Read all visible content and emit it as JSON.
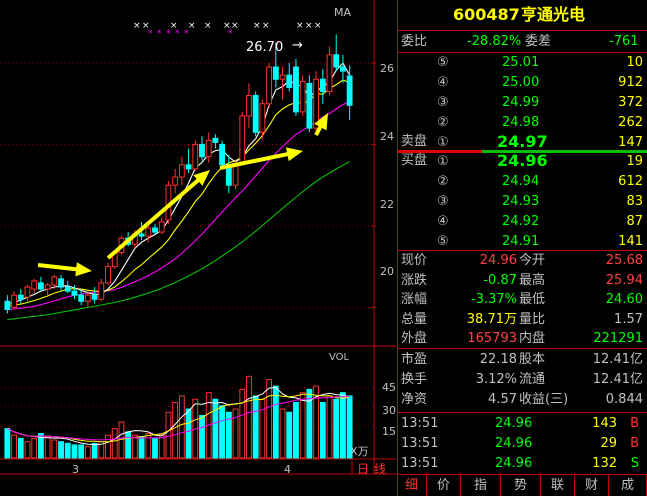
{
  "stock": {
    "code": "600487",
    "name": "亨通光电"
  },
  "weibi": {
    "label_ratio": "委比",
    "ratio": "-28.82%",
    "label_diff": "委差",
    "diff": "-761"
  },
  "sell_side_label": "卖盘",
  "buy_side_label": "买盘",
  "sell_orders": [
    {
      "level": "⑤",
      "price": "25.01",
      "volume": "10"
    },
    {
      "level": "④",
      "price": "25.00",
      "volume": "912"
    },
    {
      "level": "③",
      "price": "24.99",
      "volume": "372"
    },
    {
      "level": "②",
      "price": "24.98",
      "volume": "262"
    },
    {
      "level": "①",
      "price": "24.97",
      "volume": "147"
    }
  ],
  "buy_orders": [
    {
      "level": "①",
      "price": "24.96",
      "volume": "19"
    },
    {
      "level": "②",
      "price": "24.94",
      "volume": "612"
    },
    {
      "level": "③",
      "price": "24.93",
      "volume": "83"
    },
    {
      "level": "④",
      "price": "24.92",
      "volume": "87"
    },
    {
      "level": "⑤",
      "price": "24.91",
      "volume": "141"
    }
  ],
  "quote": [
    {
      "l1": "现价",
      "v1": "24.96",
      "l2": "今开",
      "v2": "25.68",
      "c1": "#ff4040",
      "c2": "#ff4040"
    },
    {
      "l1": "涨跌",
      "v1": "-0.87",
      "l2": "最高",
      "v2": "25.94",
      "c1": "#00ff00",
      "c2": "#ff4040"
    },
    {
      "l1": "涨幅",
      "v1": "-3.37%",
      "l2": "最低",
      "v2": "24.60",
      "c1": "#00ff00",
      "c2": "#00ff00"
    },
    {
      "l1": "总量",
      "v1": "38.71万",
      "l2": "量比",
      "v2": "1.57",
      "c1": "#ffff00",
      "c2": "#c0c0c0"
    },
    {
      "l1": "外盘",
      "v1": "165793",
      "l2": "内盘",
      "v2": "221291",
      "c1": "#ff4040",
      "c2": "#00ff00"
    }
  ],
  "fundamentals": [
    {
      "l1": "市盈",
      "v1": "22.18",
      "l2": "股本",
      "v2": "12.41亿"
    },
    {
      "l1": "换手",
      "v1": "3.12%",
      "l2": "流通",
      "v2": "12.41亿"
    },
    {
      "l1": "净资",
      "v1": "4.57",
      "l2": "收益(三)",
      "v2": "0.844"
    }
  ],
  "ticks": [
    {
      "time": "13:51",
      "price": "24.96",
      "volume": "143",
      "side": "B"
    },
    {
      "time": "13:51",
      "price": "24.96",
      "volume": "29",
      "side": "B"
    },
    {
      "time": "13:51",
      "price": "24.96",
      "volume": "132",
      "side": "S"
    }
  ],
  "tabs": [
    "细",
    "价",
    "指",
    "势",
    "联",
    "财",
    "成"
  ],
  "chart": {
    "ma_label": "MA",
    "price_peak_label": "26.70",
    "y_ticks": [
      "26",
      "24",
      "22",
      "20"
    ],
    "vol_label": "VOL",
    "vol_ticks": [
      "45",
      "30",
      "15"
    ],
    "vol_unit": "X万",
    "date_labels": [
      "3",
      "4"
    ],
    "period_tabs": [
      "日",
      "线"
    ]
  },
  "chart_data": {
    "type": "candlestick",
    "ylim": [
      19.2,
      27.3
    ],
    "up_color": "#ff3030",
    "down_color": "#00ffff",
    "candles": [
      {
        "o": 20.15,
        "h": 20.3,
        "l": 19.85,
        "c": 19.95
      },
      {
        "o": 20.0,
        "h": 20.4,
        "l": 19.95,
        "c": 20.3
      },
      {
        "o": 20.3,
        "h": 20.45,
        "l": 20.1,
        "c": 20.2
      },
      {
        "o": 20.25,
        "h": 20.55,
        "l": 20.15,
        "c": 20.5
      },
      {
        "o": 20.45,
        "h": 20.7,
        "l": 20.35,
        "c": 20.65
      },
      {
        "o": 20.6,
        "h": 20.75,
        "l": 20.4,
        "c": 20.45
      },
      {
        "o": 20.45,
        "h": 20.6,
        "l": 20.3,
        "c": 20.55
      },
      {
        "o": 20.55,
        "h": 20.8,
        "l": 20.45,
        "c": 20.75
      },
      {
        "o": 20.7,
        "h": 20.8,
        "l": 20.4,
        "c": 20.5
      },
      {
        "o": 20.5,
        "h": 20.65,
        "l": 20.35,
        "c": 20.4
      },
      {
        "o": 20.4,
        "h": 20.55,
        "l": 20.2,
        "c": 20.3
      },
      {
        "o": 20.3,
        "h": 20.45,
        "l": 20.05,
        "c": 20.15
      },
      {
        "o": 20.15,
        "h": 20.4,
        "l": 20.0,
        "c": 20.3
      },
      {
        "o": 20.3,
        "h": 20.5,
        "l": 20.1,
        "c": 20.2
      },
      {
        "o": 20.2,
        "h": 20.7,
        "l": 20.15,
        "c": 20.6
      },
      {
        "o": 20.6,
        "h": 21.1,
        "l": 20.55,
        "c": 21.0
      },
      {
        "o": 21.0,
        "h": 21.4,
        "l": 20.95,
        "c": 21.35
      },
      {
        "o": 21.35,
        "h": 21.75,
        "l": 21.3,
        "c": 21.7
      },
      {
        "o": 21.7,
        "h": 21.85,
        "l": 21.5,
        "c": 21.55
      },
      {
        "o": 21.55,
        "h": 21.9,
        "l": 21.45,
        "c": 21.8
      },
      {
        "o": 21.8,
        "h": 22.1,
        "l": 21.65,
        "c": 21.75
      },
      {
        "o": 21.75,
        "h": 22.0,
        "l": 21.6,
        "c": 21.95
      },
      {
        "o": 21.95,
        "h": 22.05,
        "l": 21.8,
        "c": 21.85
      },
      {
        "o": 21.85,
        "h": 22.2,
        "l": 21.8,
        "c": 22.1
      },
      {
        "o": 22.15,
        "h": 23.1,
        "l": 22.05,
        "c": 23.0
      },
      {
        "o": 23.0,
        "h": 23.4,
        "l": 22.8,
        "c": 23.2
      },
      {
        "o": 23.2,
        "h": 23.7,
        "l": 23.0,
        "c": 23.5
      },
      {
        "o": 23.5,
        "h": 23.9,
        "l": 23.3,
        "c": 23.4
      },
      {
        "o": 23.4,
        "h": 24.1,
        "l": 23.35,
        "c": 24.0
      },
      {
        "o": 24.0,
        "h": 24.2,
        "l": 23.6,
        "c": 23.7
      },
      {
        "o": 23.7,
        "h": 24.3,
        "l": 23.55,
        "c": 24.1
      },
      {
        "o": 24.15,
        "h": 24.25,
        "l": 23.9,
        "c": 24.05
      },
      {
        "o": 24.0,
        "h": 24.1,
        "l": 23.4,
        "c": 23.5
      },
      {
        "o": 23.5,
        "h": 23.75,
        "l": 22.8,
        "c": 23.0
      },
      {
        "o": 23.0,
        "h": 23.6,
        "l": 22.9,
        "c": 23.5
      },
      {
        "o": 23.55,
        "h": 24.8,
        "l": 23.5,
        "c": 24.7
      },
      {
        "o": 24.7,
        "h": 25.5,
        "l": 24.4,
        "c": 25.2
      },
      {
        "o": 25.2,
        "h": 25.3,
        "l": 24.2,
        "c": 24.3
      },
      {
        "o": 24.3,
        "h": 25.1,
        "l": 24.1,
        "c": 25.0
      },
      {
        "o": 25.0,
        "h": 26.0,
        "l": 24.9,
        "c": 25.9
      },
      {
        "o": 25.9,
        "h": 26.5,
        "l": 25.4,
        "c": 25.6
      },
      {
        "o": 25.6,
        "h": 25.9,
        "l": 25.1,
        "c": 25.7
      },
      {
        "o": 25.7,
        "h": 26.0,
        "l": 25.3,
        "c": 25.4
      },
      {
        "o": 25.9,
        "h": 26.1,
        "l": 24.7,
        "c": 24.8
      },
      {
        "o": 24.8,
        "h": 25.7,
        "l": 24.7,
        "c": 25.55
      },
      {
        "o": 25.5,
        "h": 25.7,
        "l": 24.3,
        "c": 24.4
      },
      {
        "o": 24.4,
        "h": 25.8,
        "l": 24.3,
        "c": 25.6
      },
      {
        "o": 25.6,
        "h": 25.85,
        "l": 25.0,
        "c": 25.3
      },
      {
        "o": 25.3,
        "h": 26.4,
        "l": 25.2,
        "c": 26.2
      },
      {
        "o": 26.2,
        "h": 26.7,
        "l": 25.8,
        "c": 25.9
      },
      {
        "o": 25.9,
        "h": 26.2,
        "l": 25.5,
        "c": 25.8
      },
      {
        "o": 25.68,
        "h": 25.94,
        "l": 24.6,
        "c": 24.96
      }
    ],
    "ma5": [
      20.1,
      20.12,
      20.18,
      20.25,
      20.32,
      20.4,
      20.45,
      20.5,
      20.52,
      20.53,
      20.48,
      20.42,
      20.36,
      20.32,
      20.33,
      20.45,
      20.64,
      20.91,
      21.18,
      21.45,
      21.6,
      21.7,
      21.79,
      21.89,
      22.14,
      22.43,
      22.73,
      23.05,
      23.42,
      23.56,
      23.76,
      23.85,
      23.87,
      23.69,
      23.57,
      23.69,
      23.97,
      24.14,
      24.44,
      24.97,
      25.34,
      25.42,
      25.56,
      25.48,
      25.41,
      25.17,
      25.3,
      25.42,
      25.53,
      25.82,
      26.0,
      25.7
    ],
    "ma10": [
      20.05,
      20.06,
      20.08,
      20.12,
      20.17,
      20.22,
      20.28,
      20.35,
      20.4,
      20.45,
      20.46,
      20.45,
      20.42,
      20.4,
      20.39,
      20.42,
      20.5,
      20.63,
      20.77,
      20.93,
      21.05,
      21.2,
      21.34,
      21.48,
      21.66,
      21.9,
      22.12,
      22.35,
      22.6,
      22.78,
      23.04,
      23.26,
      23.45,
      23.55,
      23.6,
      23.69,
      23.87,
      24.03,
      24.22,
      24.46,
      24.73,
      24.87,
      24.97,
      25.03,
      25.01,
      25.07,
      25.25,
      25.23,
      25.37,
      25.47,
      25.58,
      25.52
    ],
    "ma20": [
      19.95,
      19.96,
      19.98,
      20.0,
      20.03,
      20.07,
      20.11,
      20.16,
      20.21,
      20.26,
      20.3,
      20.33,
      20.35,
      20.37,
      20.39,
      20.41,
      20.44,
      20.49,
      20.56,
      20.63,
      20.7,
      20.78,
      20.87,
      20.97,
      21.08,
      21.19,
      21.33,
      21.48,
      21.64,
      21.8,
      21.98,
      22.16,
      22.34,
      22.52,
      22.69,
      22.86,
      23.04,
      23.23,
      23.42,
      23.61,
      23.78,
      23.95,
      24.1,
      24.25,
      24.35,
      24.45,
      24.56,
      24.67,
      24.76,
      24.87,
      24.98,
      25.05
    ],
    "ma60": [
      19.7,
      19.72,
      19.74,
      19.76,
      19.78,
      19.8,
      19.82,
      19.85,
      19.88,
      19.91,
      19.94,
      19.97,
      20.0,
      20.03,
      20.06,
      20.09,
      20.12,
      20.16,
      20.2,
      20.25,
      20.3,
      20.35,
      20.41,
      20.47,
      20.54,
      20.61,
      20.69,
      20.77,
      20.86,
      20.95,
      21.05,
      21.15,
      21.26,
      21.37,
      21.49,
      21.61,
      21.74,
      21.87,
      22.01,
      22.15,
      22.29,
      22.43,
      22.57,
      22.71,
      22.84,
      22.97,
      23.09,
      23.2,
      23.3,
      23.4,
      23.49,
      23.58
    ],
    "volumes": [
      18,
      14,
      12,
      10,
      12,
      15,
      13,
      11,
      10,
      9,
      8,
      8,
      7,
      9,
      10,
      14,
      18,
      22,
      16,
      14,
      13,
      15,
      12,
      14,
      28,
      34,
      38,
      30,
      36,
      26,
      40,
      36,
      32,
      28,
      30,
      42,
      50,
      38,
      36,
      48,
      44,
      30,
      28,
      34,
      40,
      42,
      44,
      34,
      38,
      36,
      40,
      38
    ],
    "vol_ylim": [
      0,
      60
    ]
  }
}
